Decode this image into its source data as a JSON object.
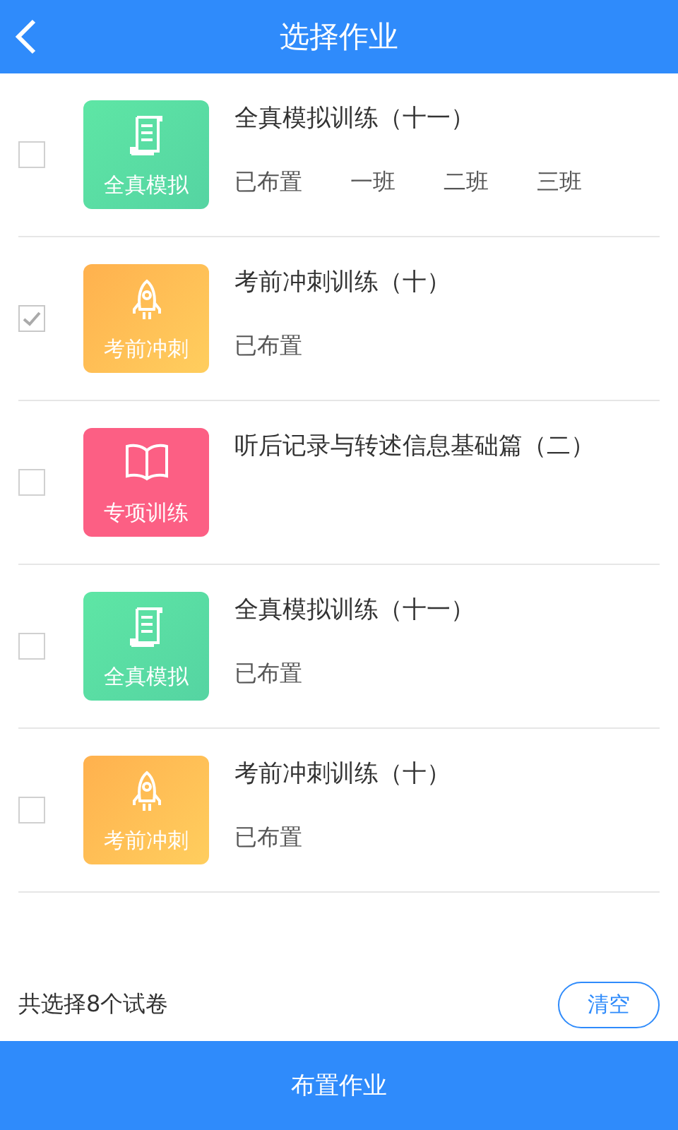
{
  "header": {
    "title": "选择作业"
  },
  "items": [
    {
      "checked": false,
      "kind": "mock",
      "tile_label": "全真模拟",
      "title": "全真模拟训练（十一）",
      "status": "已布置",
      "classes": [
        "一班",
        "二班",
        "三班"
      ]
    },
    {
      "checked": true,
      "kind": "sprint",
      "tile_label": "考前冲刺",
      "title": "考前冲刺训练（十）",
      "status": "已布置"
    },
    {
      "checked": false,
      "kind": "special",
      "tile_label": "专项训练",
      "title": "听后记录与转述信息基础篇（二）"
    },
    {
      "checked": false,
      "kind": "mock",
      "tile_label": "全真模拟",
      "title": "全真模拟训练（十一）",
      "status": "已布置"
    },
    {
      "checked": false,
      "kind": "sprint",
      "tile_label": "考前冲刺",
      "title": "考前冲刺训练（十）",
      "status": "已布置"
    }
  ],
  "footer": {
    "summary": "共选择8个试卷",
    "clear_button": "清空",
    "assign_button": "布置作业"
  }
}
